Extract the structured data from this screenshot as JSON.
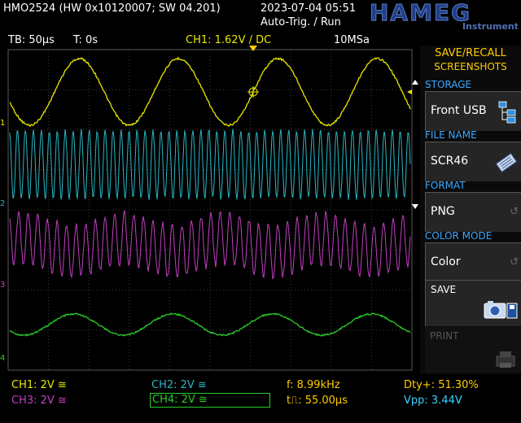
{
  "topbar": {
    "device": "HMO2524 (HW 0x10120007; SW 04.201)",
    "datetime": "2023-07-04 05:51",
    "trigger_mode": "Auto-Trig. / Run",
    "brand": "HAMEG",
    "brand_sub": "Instruments"
  },
  "infobar": {
    "timebase": "TB: 50µs",
    "trigger_time": "T: 0s",
    "ch1_setting": "CH1: 1.62V / DC",
    "sample_rate": "10MSa"
  },
  "markers": {
    "ch1": "1",
    "ch2": "2",
    "ch3": "3",
    "ch4": "4"
  },
  "sidebar": {
    "title_line1": "SAVE/RECALL",
    "title_line2": "SCREENSHOTS",
    "storage": {
      "category": "STORAGE",
      "value": "Front USB"
    },
    "file_name": {
      "category": "FILE NAME",
      "value": "SCR46"
    },
    "format": {
      "category": "FORMAT",
      "value": "PNG"
    },
    "color_mode": {
      "category": "COLOR MODE",
      "value": "Color"
    },
    "save_label": "SAVE",
    "print_label": "PRINT"
  },
  "bottombar": {
    "ch1": "CH1: 2V ≅",
    "ch2": "CH2: 2V ≅",
    "ch3": "CH3: 2V ≅",
    "ch4": "CH4: 2V ≅",
    "frequency": "f: 8.99kHz",
    "period": "t⎍: 55.00µs",
    "duty": "Dty+: 51.30%",
    "vpp": "Vpp: 3.44V"
  },
  "colors": {
    "ch1": "#e8e800",
    "ch2": "#2ab5c5",
    "ch3": "#c040c0",
    "ch4": "#2bcc2b",
    "accent": "#ffcc00",
    "category": "#3aa7ff"
  }
}
